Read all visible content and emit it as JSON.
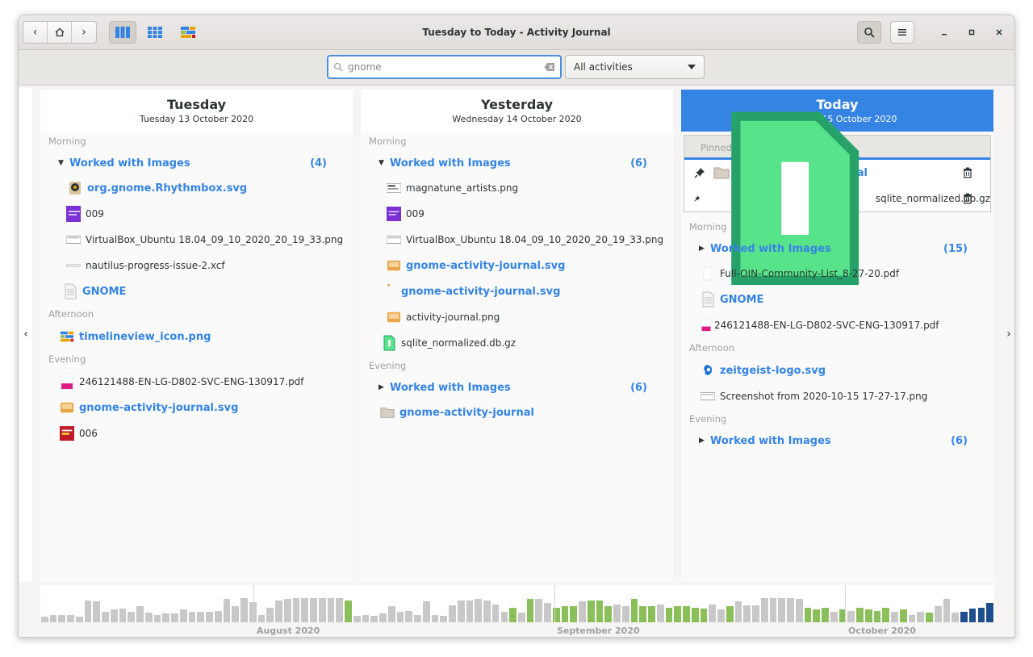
{
  "window": {
    "title": "Tuesday to Today - Activity Journal"
  },
  "search": {
    "value": "gnome",
    "placeholder": ""
  },
  "filter": {
    "selected": "All activities"
  },
  "columns": [
    {
      "day": "Tuesday",
      "date": "Tuesday 13 October 2020",
      "sections": {
        "morning": "Morning",
        "afternoon": "Afternoon",
        "evening": "Evening"
      },
      "morning_group": {
        "label": "Worked with Images",
        "count": "(4)"
      },
      "morning_items": [
        "org.gnome.Rhythmbox.svg",
        "009",
        "VirtualBox_Ubuntu 18.04_09_10_2020_20_19_33.png",
        "nautilus-progress-issue-2.xcf",
        "GNOME"
      ],
      "afternoon_items": [
        "timelineview_icon.png"
      ],
      "evening_items": [
        "246121488-EN-LG-D802-SVC-ENG-130917.pdf",
        "gnome-activity-journal.svg",
        "006"
      ]
    },
    {
      "day": "Yesterday",
      "date": "Wednesday 14 October 2020",
      "sections": {
        "morning": "Morning",
        "evening": "Evening"
      },
      "morning_group": {
        "label": "Worked with Images",
        "count": "(6)"
      },
      "morning_items": [
        "magnatune_artists.png",
        "009",
        "VirtualBox_Ubuntu 18.04_09_10_2020_20_19_33.png",
        "gnome-activity-journal.svg",
        "gnome-activity-journal.svg",
        "activity-journal.png",
        "sqlite_normalized.db.gz"
      ],
      "evening_group": {
        "label": "Worked with Images",
        "count": "(6)"
      },
      "evening_items": [
        "gnome-activity-journal"
      ]
    },
    {
      "day": "Today",
      "date": "Thursday 15 October 2020",
      "pinned_title": "Pinned Items",
      "pinned_items": [
        "gnome-activity-journal",
        "sqlite_normalized.db.gz"
      ],
      "sections": {
        "morning": "Morning",
        "afternoon": "Afternoon",
        "evening": "Evening"
      },
      "morning_group": {
        "label": "Worked with Images",
        "count": "(15)"
      },
      "morning_items": [
        "Full-OIN-Community-List_8-27-20.pdf",
        "GNOME",
        "246121488-EN-LG-D802-SVC-ENG-130917.pdf"
      ],
      "afternoon_items": [
        "zeitgeist-logo.svg",
        "Screenshot from 2020-10-15 17-27-17.png"
      ],
      "evening_group": {
        "label": "Worked with Images",
        "count": "(6)"
      }
    }
  ],
  "timeline": {
    "months": [
      "August 2020",
      "September 2020",
      "October 2020"
    ],
    "colors": {
      "past": "#c8c8c8",
      "match": "#8bbf5a",
      "selected": "#1f4e8c"
    },
    "bars": [
      {
        "v": 0.12,
        "c": "past"
      },
      {
        "v": 0.2,
        "c": "past"
      },
      {
        "v": 0.18,
        "c": "past"
      },
      {
        "v": 0.2,
        "c": "past"
      },
      {
        "v": 0.12,
        "c": "past"
      },
      {
        "v": 0.9,
        "c": "past"
      },
      {
        "v": 0.85,
        "c": "past"
      },
      {
        "v": 0.35,
        "c": "past"
      },
      {
        "v": 0.45,
        "c": "past"
      },
      {
        "v": 0.5,
        "c": "past"
      },
      {
        "v": 0.35,
        "c": "past"
      },
      {
        "v": 0.6,
        "c": "past"
      },
      {
        "v": 0.3,
        "c": "past"
      },
      {
        "v": 0.2,
        "c": "past"
      },
      {
        "v": 0.25,
        "c": "past"
      },
      {
        "v": 0.25,
        "c": "past"
      },
      {
        "v": 0.45,
        "c": "past"
      },
      {
        "v": 0.35,
        "c": "past"
      },
      {
        "v": 0.35,
        "c": "past"
      },
      {
        "v": 0.35,
        "c": "past"
      },
      {
        "v": 0.4,
        "c": "past"
      },
      {
        "v": 0.95,
        "c": "past"
      },
      {
        "v": 0.6,
        "c": "past"
      },
      {
        "v": 1.0,
        "c": "past"
      },
      {
        "v": 0.8,
        "c": "past"
      },
      {
        "v": 0.2,
        "c": "past"
      },
      {
        "v": 0.55,
        "c": "past"
      },
      {
        "v": 0.9,
        "c": "past"
      },
      {
        "v": 0.95,
        "c": "past"
      },
      {
        "v": 1.0,
        "c": "past"
      },
      {
        "v": 1.0,
        "c": "past"
      },
      {
        "v": 1.0,
        "c": "past"
      },
      {
        "v": 1.0,
        "c": "past"
      },
      {
        "v": 1.0,
        "c": "past"
      },
      {
        "v": 1.0,
        "c": "past"
      },
      {
        "v": 0.9,
        "c": "match"
      },
      {
        "v": 0.15,
        "c": "past"
      },
      {
        "v": 0.2,
        "c": "past"
      },
      {
        "v": 0.15,
        "c": "past"
      },
      {
        "v": 0.25,
        "c": "past"
      },
      {
        "v": 0.6,
        "c": "past"
      },
      {
        "v": 0.35,
        "c": "past"
      },
      {
        "v": 0.4,
        "c": "past"
      },
      {
        "v": 0.2,
        "c": "past"
      },
      {
        "v": 0.85,
        "c": "past"
      },
      {
        "v": 0.2,
        "c": "past"
      },
      {
        "v": 0.15,
        "c": "past"
      },
      {
        "v": 0.65,
        "c": "past"
      },
      {
        "v": 0.9,
        "c": "past"
      },
      {
        "v": 0.9,
        "c": "past"
      },
      {
        "v": 0.95,
        "c": "past"
      },
      {
        "v": 0.9,
        "c": "past"
      },
      {
        "v": 0.7,
        "c": "past"
      },
      {
        "v": 0.35,
        "c": "past"
      },
      {
        "v": 0.55,
        "c": "match"
      },
      {
        "v": 0.3,
        "c": "past"
      },
      {
        "v": 0.95,
        "c": "match"
      },
      {
        "v": 0.95,
        "c": "past"
      },
      {
        "v": 0.75,
        "c": "past"
      },
      {
        "v": 0.55,
        "c": "match"
      },
      {
        "v": 0.6,
        "c": "match"
      },
      {
        "v": 0.6,
        "c": "match"
      },
      {
        "v": 0.85,
        "c": "past"
      },
      {
        "v": 0.9,
        "c": "match"
      },
      {
        "v": 0.9,
        "c": "match"
      },
      {
        "v": 0.6,
        "c": "match"
      },
      {
        "v": 0.7,
        "c": "past"
      },
      {
        "v": 0.6,
        "c": "past"
      },
      {
        "v": 0.95,
        "c": "match"
      },
      {
        "v": 0.6,
        "c": "match"
      },
      {
        "v": 0.6,
        "c": "match"
      },
      {
        "v": 0.7,
        "c": "past"
      },
      {
        "v": 0.55,
        "c": "match"
      },
      {
        "v": 0.6,
        "c": "match"
      },
      {
        "v": 0.6,
        "c": "match"
      },
      {
        "v": 0.55,
        "c": "match"
      },
      {
        "v": 0.5,
        "c": "match"
      },
      {
        "v": 0.7,
        "c": "past"
      },
      {
        "v": 0.45,
        "c": "past"
      },
      {
        "v": 0.6,
        "c": "match"
      },
      {
        "v": 0.85,
        "c": "past"
      },
      {
        "v": 0.65,
        "c": "past"
      },
      {
        "v": 0.65,
        "c": "past"
      },
      {
        "v": 1.0,
        "c": "past"
      },
      {
        "v": 1.0,
        "c": "past"
      },
      {
        "v": 1.0,
        "c": "past"
      },
      {
        "v": 1.0,
        "c": "past"
      },
      {
        "v": 0.95,
        "c": "past"
      },
      {
        "v": 0.55,
        "c": "match"
      },
      {
        "v": 0.45,
        "c": "match"
      },
      {
        "v": 0.55,
        "c": "match"
      },
      {
        "v": 0.35,
        "c": "past"
      },
      {
        "v": 0.45,
        "c": "match"
      },
      {
        "v": 0.4,
        "c": "past"
      },
      {
        "v": 0.55,
        "c": "match"
      },
      {
        "v": 0.45,
        "c": "match"
      },
      {
        "v": 0.4,
        "c": "match"
      },
      {
        "v": 0.55,
        "c": "match"
      },
      {
        "v": 0.35,
        "c": "past"
      },
      {
        "v": 0.45,
        "c": "match"
      },
      {
        "v": 0.2,
        "c": "past"
      },
      {
        "v": 0.35,
        "c": "past"
      },
      {
        "v": 0.3,
        "c": "match"
      },
      {
        "v": 0.6,
        "c": "past"
      },
      {
        "v": 0.95,
        "c": "past"
      },
      {
        "v": 0.3,
        "c": "past"
      },
      {
        "v": 0.35,
        "c": "selected"
      },
      {
        "v": 0.5,
        "c": "selected"
      },
      {
        "v": 0.55,
        "c": "selected"
      },
      {
        "v": 0.75,
        "c": "selected"
      }
    ]
  }
}
